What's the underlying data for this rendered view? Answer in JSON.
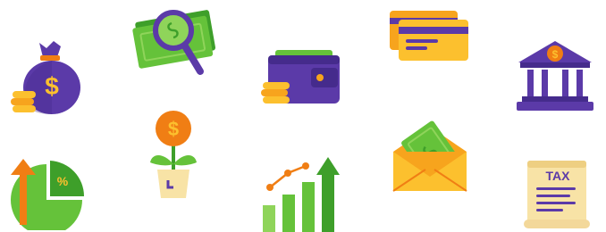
{
  "icons": [
    {
      "name": "money-bag-icon"
    },
    {
      "name": "money-magnifier-icon"
    },
    {
      "name": "wallet-icon"
    },
    {
      "name": "credit-cards-icon"
    },
    {
      "name": "bank-icon"
    },
    {
      "name": "pie-chart-growth-icon"
    },
    {
      "name": "money-plant-icon"
    },
    {
      "name": "bar-chart-growth-icon"
    },
    {
      "name": "money-envelope-icon"
    },
    {
      "name": "tax-document-icon"
    }
  ],
  "tax_document": {
    "label": "TAX"
  },
  "currency_symbols": {
    "dollar": "$",
    "percent": "%"
  },
  "colors": {
    "purple": "#5b3aa8",
    "purple_dark": "#452b8c",
    "orange": "#f7a41d",
    "orange_deep": "#f07e14",
    "yellow": "#fcc02e",
    "green": "#65c23a",
    "green_dark": "#3e9f2a",
    "green_light": "#8fd45a",
    "paper": "#f8e3a6"
  }
}
